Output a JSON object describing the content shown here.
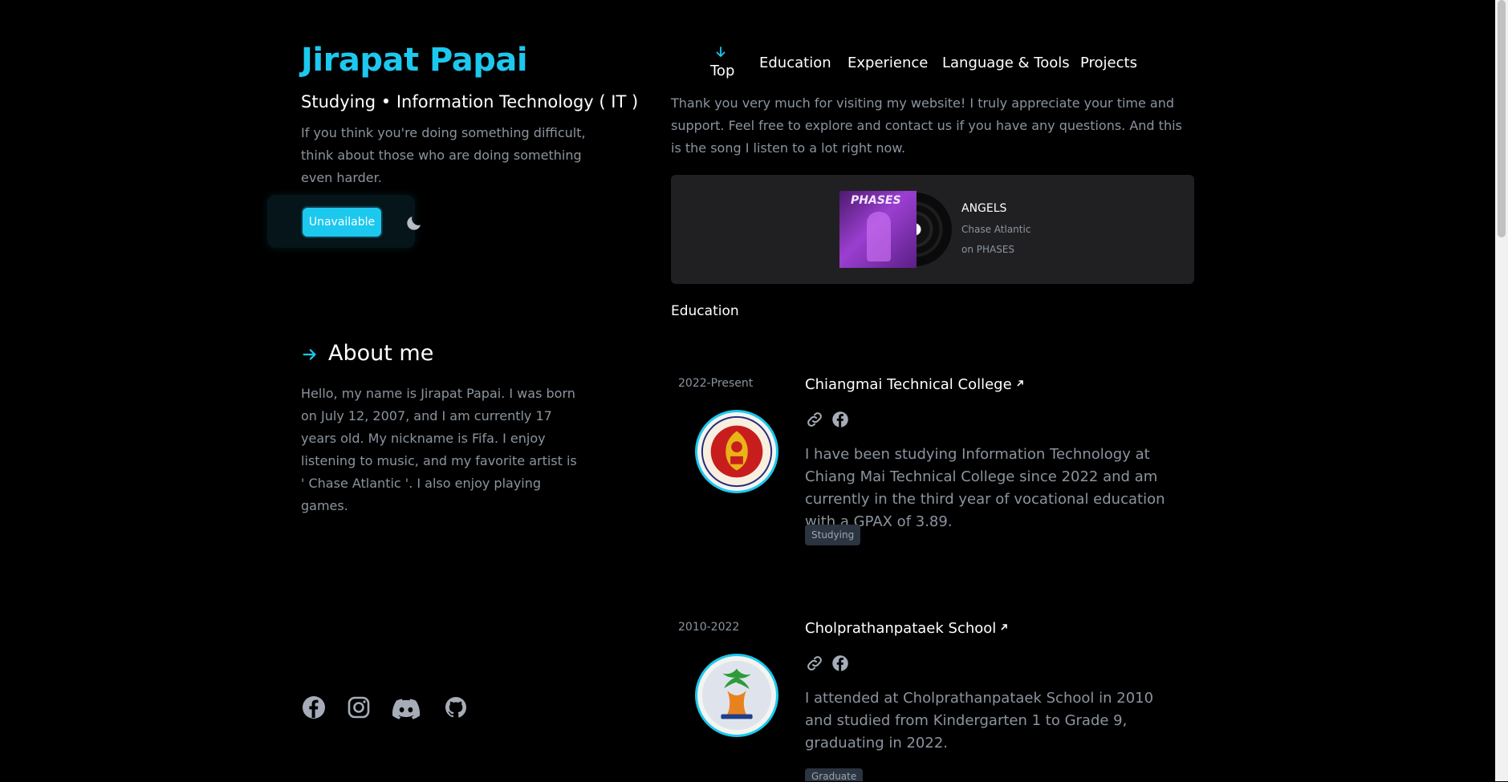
{
  "profile": {
    "name": "Jirapat Papai",
    "subtitle": "Studying • Information Technology ( IT )",
    "quote": "If you think you're doing something difficult, think about those who are doing something even harder.",
    "status_label": "Unavailable"
  },
  "about": {
    "title": "About me",
    "text": "Hello, my name is Jirapat Papai. I was born on July 12, 2007, and I am currently 17 years old. My nickname is Fifa. I enjoy listening to music, and my favorite artist is ' Chase Atlantic '. I also enjoy playing games."
  },
  "social": [
    "facebook-icon",
    "instagram-icon",
    "discord-icon",
    "github-icon"
  ],
  "nav": {
    "top": "Top",
    "items": [
      "Education",
      "Experience",
      "Language & Tools",
      "Projects"
    ]
  },
  "thanks": "Thank you very much for visiting my website! I truly appreciate your time and support. Feel free to explore and contact us if you have any questions. And this is the song I listen to a lot right now.",
  "player": {
    "cover_text": "PHASES",
    "song": "ANGELS",
    "artist": "Chase Atlantic",
    "album": "on PHASES"
  },
  "education": {
    "heading": "Education",
    "entries": [
      {
        "date": "2022-Present",
        "school": "Chiangmai Technical College",
        "description": "I have been studying Information Technology at Chiang Mai Technical College since 2022 and am currently in the third year of vocational education with a GPAX of 3.89.",
        "tag": "Studying"
      },
      {
        "date": "2010-2022",
        "school": "Cholprathanpataek School",
        "description": "I attended at Cholprathanpataek School in 2010 and studied from Kindergarten 1 to Grade 9, graduating in 2022.",
        "tag": "Graduate"
      }
    ]
  },
  "colors": {
    "accent": "#1cc8ee",
    "background": "#000000",
    "muted": "#8b949e",
    "card": "#202022"
  }
}
